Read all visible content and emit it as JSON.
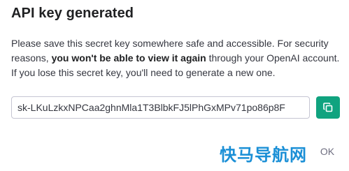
{
  "dialog": {
    "title": "API key generated",
    "message_part1": "Please save this secret key somewhere safe and accessible. For security reasons, ",
    "message_bold": "you won't be able to view it again",
    "message_part2": " through your OpenAI account. If you lose this secret key, you'll need to generate a new one.",
    "api_key_value": "sk-LKuLzkxNPCaa2ghnMla1T3BlbkFJ5lPhGxMPv71po86p8F",
    "copy_icon": "copy-icon",
    "ok_label": "OK",
    "accent_color": "#10a37f"
  },
  "watermark": {
    "text": "快马导航网"
  }
}
